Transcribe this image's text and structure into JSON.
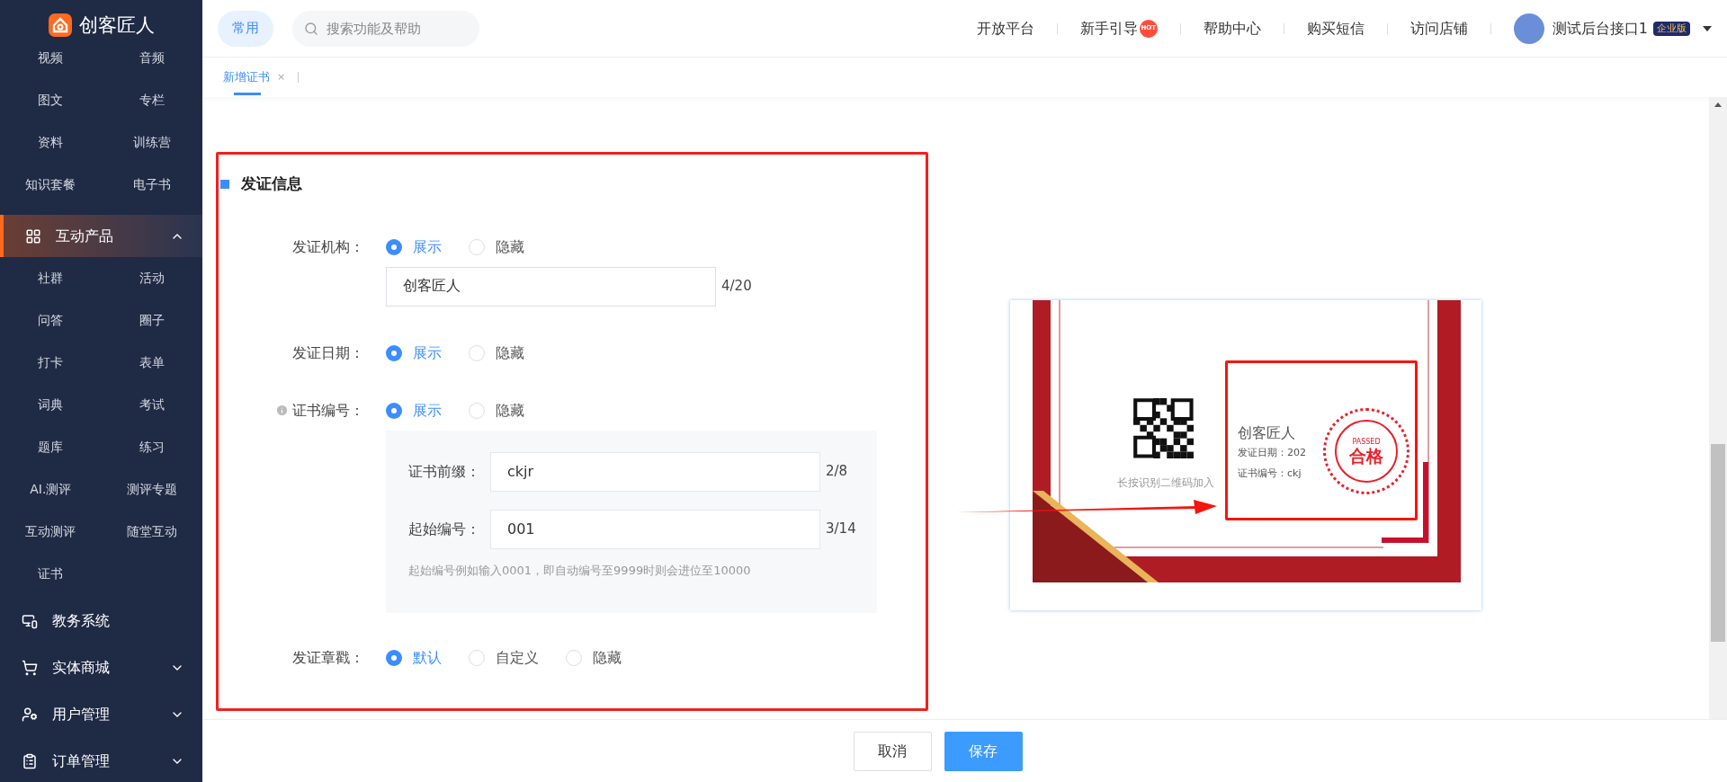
{
  "sidebar": {
    "logo": "创客匠人",
    "top_items": [
      "视频",
      "音频",
      "图文",
      "专栏",
      "资料",
      "训练营",
      "知识套餐",
      "电子书"
    ],
    "menus": [
      {
        "label": "互动产品",
        "kind": "grid",
        "expanded": true,
        "selected": true,
        "children": [
          "社群",
          "活动",
          "问答",
          "圈子",
          "打卡",
          "表单",
          "词典",
          "考试",
          "题库",
          "练习",
          "AI.测评",
          "测评专题",
          "互动测评",
          "随堂互动",
          "证书"
        ]
      },
      {
        "label": "教务系统",
        "kind": "plain",
        "selected": false
      },
      {
        "label": "实体商城",
        "kind": "cart",
        "expanded": false,
        "selected": false
      },
      {
        "label": "用户管理",
        "kind": "user",
        "expanded": false,
        "selected": false
      },
      {
        "label": "订单管理",
        "kind": "order",
        "expanded": false,
        "selected": false
      }
    ]
  },
  "topbar": {
    "common_button": "常用",
    "search": {
      "placeholder": "搜索功能及帮助"
    },
    "links": [
      {
        "label": "开放平台"
      },
      {
        "label": "新手引导",
        "badge": "HOT"
      },
      {
        "label": "帮助中心"
      },
      {
        "label": "购买短信"
      },
      {
        "label": "访问店铺"
      }
    ],
    "user": {
      "name": "测试后台接口1",
      "edition": "企业版"
    }
  },
  "tabs": [
    {
      "label": "新增证书",
      "selected": true,
      "close": "×"
    }
  ],
  "form": {
    "title": "发证信息",
    "rows": [
      {
        "label": "发证机构：",
        "options": [
          {
            "label": "展示",
            "selected": true
          },
          {
            "label": "隐藏",
            "selected": false
          }
        ],
        "input": {
          "value": "创客匠人",
          "count": "4/20"
        }
      },
      {
        "label": "发证日期：",
        "options": [
          {
            "label": "展示",
            "selected": true
          },
          {
            "label": "隐藏",
            "selected": false
          }
        ]
      },
      {
        "label": "证书编号：",
        "info": true,
        "options": [
          {
            "label": "展示",
            "selected": true
          },
          {
            "label": "隐藏",
            "selected": false
          }
        ],
        "panel": {
          "fields": [
            {
              "label": "证书前缀：",
              "value": "ckjr",
              "count": "2/8"
            },
            {
              "label": "起始编号：",
              "value": "001",
              "count": "3/14"
            }
          ],
          "hint": "起始编号例如输入0001，即自动编号至9999时则会进位至10000"
        }
      },
      {
        "label": "发证章戳：",
        "options": [
          {
            "label": "默认",
            "selected": true
          },
          {
            "label": "自定义",
            "selected": false
          },
          {
            "label": "隐藏",
            "selected": false
          }
        ]
      }
    ]
  },
  "preview": {
    "qr_caption": "长按识别二维码加入",
    "org": "创客匠人",
    "date_text": "发证日期：202",
    "number_text": "证书编号：ckj",
    "stamp_ring": "PASSED",
    "stamp_text": "合格"
  },
  "footer": {
    "buttons": [
      {
        "label": "取消",
        "kind": "secondary"
      },
      {
        "label": "保存",
        "kind": "primary"
      }
    ]
  }
}
